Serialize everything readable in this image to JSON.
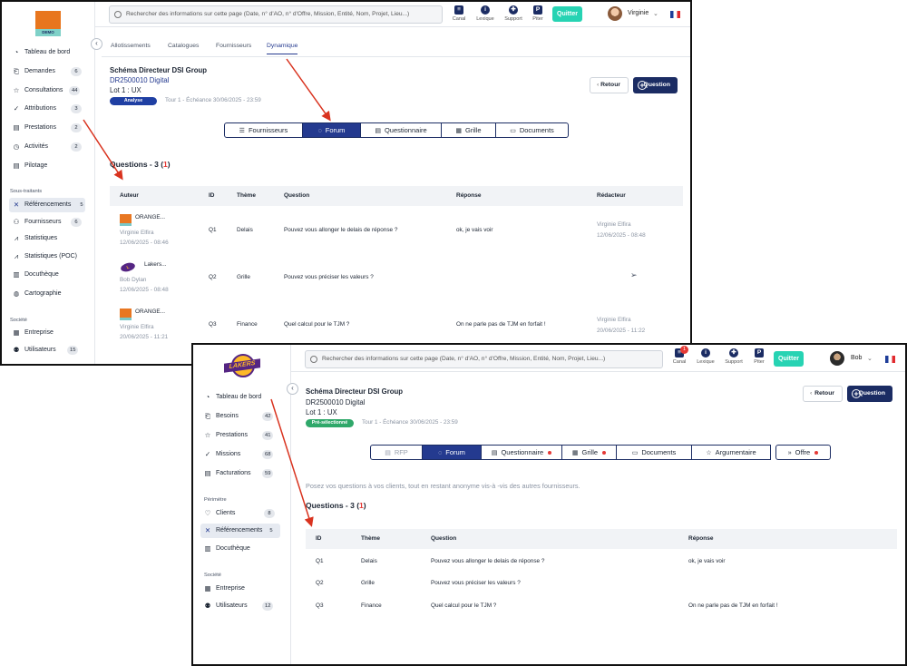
{
  "w1": {
    "search_placeholder": "Rechercher des informations sur cette page (Date, n° d'AO, n° d'Offre, Mission, Entité, Nom, Projet, Lieu...)",
    "toolbar": [
      {
        "icon": "chat-icon",
        "label": "Canal"
      },
      {
        "icon": "info-icon",
        "label": "Lexique"
      },
      {
        "icon": "lifebuoy-icon",
        "label": "Support"
      },
      {
        "icon": "piter-icon",
        "label": "Piter"
      }
    ],
    "quit_label": "Quitter",
    "user_name": "Virginie",
    "logo_text": "DEMO",
    "nav": [
      {
        "label": "Tableau de bord",
        "icon": "dashboard-icon",
        "count": ""
      },
      {
        "label": "Demandes",
        "icon": "demand-icon",
        "count": "6"
      },
      {
        "label": "Consultations",
        "icon": "star-icon",
        "count": "44"
      },
      {
        "label": "Attributions",
        "icon": "check-icon",
        "count": "3"
      },
      {
        "label": "Prestations",
        "icon": "doc-icon",
        "count": "2"
      },
      {
        "label": "Activités",
        "icon": "clock-icon",
        "count": "2"
      },
      {
        "label": "Pilotage",
        "icon": "doc-icon",
        "count": ""
      }
    ],
    "section_soustraitants": "Sous-traitants",
    "nav2": [
      {
        "label": "Référencements",
        "icon": "network-icon",
        "count": "5"
      },
      {
        "label": "Fournisseurs",
        "icon": "suppliers-icon",
        "count": "6"
      },
      {
        "label": "Statistiques",
        "icon": "chart-icon",
        "count": ""
      },
      {
        "label": "Statistiques (POC)",
        "icon": "chart-icon",
        "count": ""
      },
      {
        "label": "Docuthèque",
        "icon": "books-icon",
        "count": ""
      },
      {
        "label": "Cartographie",
        "icon": "globe-icon",
        "count": ""
      }
    ],
    "section_societe": "Société",
    "nav3": [
      {
        "label": "Entreprise",
        "icon": "building-icon",
        "count": ""
      },
      {
        "label": "Utilisateurs",
        "icon": "users-icon",
        "count": "15"
      }
    ],
    "subtabs": [
      "Allotissements",
      "Catalogues",
      "Fournisseurs",
      "Dynamique"
    ],
    "title": "Schéma Directeur DSI Group",
    "code": "DR2500010 Digital",
    "lot": "Lot 1 : UX",
    "badge": "Analyse",
    "tour": "Tour 1 - Échéance 30/06/2025 - 23:59",
    "back_label": "Retour",
    "question_label": "Question",
    "segments": [
      {
        "label": "Fournisseurs",
        "icon": "☰"
      },
      {
        "label": "Forum",
        "icon": "💬"
      },
      {
        "label": "Questionnaire",
        "icon": "▤"
      },
      {
        "label": "Grille",
        "icon": "▦"
      },
      {
        "label": "Documents",
        "icon": "▭"
      }
    ],
    "questions_label": "Questions - 3 (",
    "questions_red": "1",
    "questions_close": ")",
    "headers": [
      "Auteur",
      "ID",
      "Thème",
      "Question",
      "Réponse",
      "Rédacteur"
    ],
    "rows": [
      {
        "company": "ORANGE...",
        "author": "Virginie Elfira",
        "date": "12/06/2025 - 08:46",
        "id": "Q1",
        "theme": "Delais",
        "question": "Pouvez vous allonger le delais de réponse ?",
        "answer": "ok, je vais voir",
        "redacteur": "Virginie Elfira",
        "red_date": "12/06/2025 - 08:48"
      },
      {
        "company": "Lakers...",
        "author": "Bob Dylan",
        "date": "12/06/2025 - 08:48",
        "id": "Q2",
        "theme": "Grille",
        "question": "Pouvez vous préciser les valeurs ?",
        "answer": "",
        "redacteur": "",
        "red_date": ""
      },
      {
        "company": "ORANGE...",
        "author": "Virginie Elfira",
        "date": "20/06/2025 - 11:21",
        "id": "Q3",
        "theme": "Finance",
        "question": "Quel calcul pour le TJM ?",
        "answer": "On ne parle pas de TJM en forfait !",
        "redacteur": "Virginie Elfira",
        "red_date": "20/06/2025 - 11:22"
      }
    ]
  },
  "w2": {
    "search_placeholder": "Rechercher des informations sur cette page (Date, n° d'AO, n° d'Offre, Mission, Entité, Nom, Projet, Lieu...)",
    "canal_badge": "1",
    "toolbar": [
      {
        "icon": "chat-icon",
        "label": "Canal"
      },
      {
        "icon": "info-icon",
        "label": "Lexique"
      },
      {
        "icon": "lifebuoy-icon",
        "label": "Support"
      },
      {
        "icon": "piter-icon",
        "label": "Piter"
      }
    ],
    "quit_label": "Quitter",
    "user_name": "Bob",
    "logo_text": "LAKERS",
    "nav": [
      {
        "label": "Tableau de bord",
        "icon": "dashboard-icon",
        "count": ""
      },
      {
        "label": "Besoins",
        "icon": "demand-icon",
        "count": "42"
      },
      {
        "label": "Prestations",
        "icon": "star-icon",
        "count": "41"
      },
      {
        "label": "Missions",
        "icon": "check-icon",
        "count": "68"
      },
      {
        "label": "Facturations",
        "icon": "invoice-icon",
        "count": "59"
      }
    ],
    "section_perimetre": "Périmètre",
    "nav2": [
      {
        "label": "Clients",
        "icon": "heart-icon",
        "count": "8"
      },
      {
        "label": "Référencements",
        "icon": "network-icon",
        "count": "5"
      },
      {
        "label": "Docuthèque",
        "icon": "books-icon",
        "count": ""
      }
    ],
    "section_societe": "Société",
    "nav3": [
      {
        "label": "Entreprise",
        "icon": "building-icon",
        "count": ""
      },
      {
        "label": "Utilisateurs",
        "icon": "users-icon",
        "count": "12"
      }
    ],
    "title": "Schéma Directeur DSI Group",
    "code": "DR2500010 Digital",
    "lot": "Lot 1 : UX",
    "badge": "Pré-sélectionné",
    "tour": "Tour 1 - Échéance 30/06/2025 - 23:59",
    "back_label": "Retour",
    "question_label": "Question",
    "segments": [
      {
        "label": "RFP",
        "icon": "▤"
      },
      {
        "label": "Forum",
        "icon": "💬"
      },
      {
        "label": "Questionnaire",
        "icon": "▤"
      },
      {
        "label": "Grille",
        "icon": "▦"
      },
      {
        "label": "Documents",
        "icon": "▭"
      },
      {
        "label": "Argumentaire",
        "icon": "☆"
      },
      {
        "label": "Offre",
        "icon": "»"
      }
    ],
    "intro": "Posez vos questions à vos clients, tout en restant anonyme vis-à -vis des autres fournisseurs.",
    "questions_label": "Questions - 3 (",
    "questions_red": "1",
    "questions_close": ")",
    "headers": [
      "ID",
      "Thème",
      "Question",
      "Réponse"
    ],
    "rows": [
      {
        "id": "Q1",
        "theme": "Delais",
        "question": "Pouvez vous allonger le delais de réponse ?",
        "answer": "ok, je vais voir"
      },
      {
        "id": "Q2",
        "theme": "Grille",
        "question": "Pouvez vous préciser les valeurs ?",
        "answer": ""
      },
      {
        "id": "Q3",
        "theme": "Finance",
        "question": "Quel calcul pour le TJM ?",
        "answer": "On ne parle pas de TJM en forfait !"
      }
    ]
  },
  "colors": {
    "navy": "#1b2c63",
    "accent": "#243a8f",
    "quit": "#27d3b3",
    "analyse": "#1f3fa3",
    "preselect": "#2fa86a",
    "annotation": "#d9331f"
  }
}
